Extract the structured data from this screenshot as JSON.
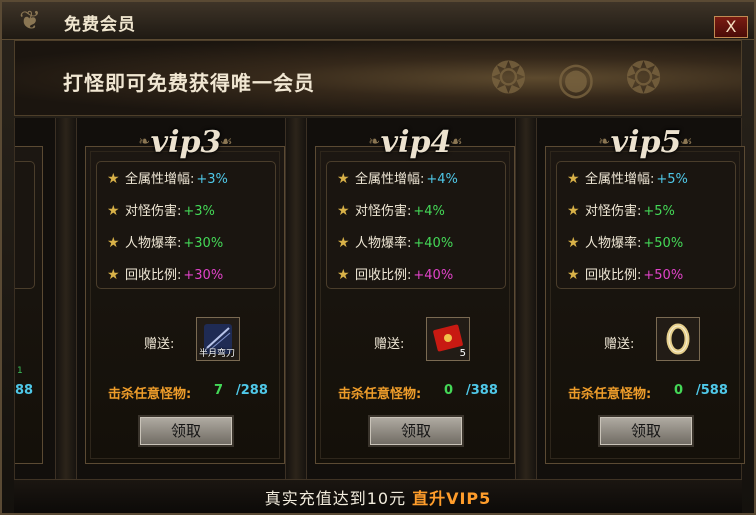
{
  "window": {
    "title": "免费会员",
    "close_label": "X"
  },
  "banner": {
    "text": "打怪即可免费获得唯一会员"
  },
  "left_partial": {
    "kill_max": "88",
    "tag": "1"
  },
  "cards": [
    {
      "vip": "vip3",
      "stats": [
        {
          "label": "全属性增幅:",
          "value": "+3%",
          "color": "#4fc8e8"
        },
        {
          "label": "对怪伤害:",
          "value": "+3%",
          "color": "#44d857"
        },
        {
          "label": "人物爆率:",
          "value": "+30%",
          "color": "#44d857"
        },
        {
          "label": "回收比例:",
          "value": "+30%",
          "color": "#e043c8"
        }
      ],
      "gift_label": "赠送:",
      "gift": {
        "icon": "scroll-icon",
        "caption": "半月弯刀",
        "qty": ""
      },
      "kill_label": "击杀任意怪物:",
      "kill_current": "7",
      "kill_max": "/288",
      "button": "领取"
    },
    {
      "vip": "vip4",
      "stats": [
        {
          "label": "全属性增幅:",
          "value": "+4%",
          "color": "#4fc8e8"
        },
        {
          "label": "对怪伤害:",
          "value": "+4%",
          "color": "#44d857"
        },
        {
          "label": "人物爆率:",
          "value": "+40%",
          "color": "#44d857"
        },
        {
          "label": "回收比例:",
          "value": "+40%",
          "color": "#e043c8"
        }
      ],
      "gift_label": "赠送:",
      "gift": {
        "icon": "red-envelope-icon",
        "caption": "",
        "qty": "5"
      },
      "kill_label": "击杀任意怪物:",
      "kill_current": "0",
      "kill_max": "/388",
      "button": "领取"
    },
    {
      "vip": "vip5",
      "stats": [
        {
          "label": "全属性增幅:",
          "value": "+5%",
          "color": "#4fc8e8"
        },
        {
          "label": "对怪伤害:",
          "value": "+5%",
          "color": "#44d857"
        },
        {
          "label": "人物爆率:",
          "value": "+50%",
          "color": "#44d857"
        },
        {
          "label": "回收比例:",
          "value": "+50%",
          "color": "#e043c8"
        }
      ],
      "gift_label": "赠送:",
      "gift": {
        "icon": "gold-bracelet-icon",
        "caption": "",
        "qty": ""
      },
      "kill_label": "击杀任意怪物:",
      "kill_current": "0",
      "kill_max": "/588",
      "button": "领取"
    }
  ],
  "footer": {
    "text": "真实充值达到10元",
    "link": "直升VIP5"
  }
}
